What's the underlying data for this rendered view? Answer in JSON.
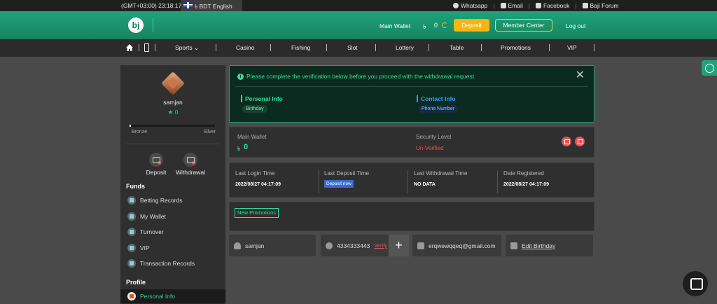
{
  "topbar": {
    "time": "(GMT+03:00) 23:18:17",
    "language": "৳ BDT English",
    "links": [
      "Whatsapp",
      "Email",
      "Facebook",
      "Baji Forum"
    ]
  },
  "header": {
    "logo": "bj",
    "main_wallet_label": "Main Wallet",
    "currency": "৳",
    "balance": "0",
    "deposit_label": "Deposit",
    "member_center_label": "Member Center",
    "logout_label": "Log out",
    "accent": "#1fa37a",
    "deposit_color": "#f8b510"
  },
  "nav": {
    "items": [
      "Sports ⌄",
      "Casino",
      "Fishing",
      "Slot",
      "Lottery",
      "Table",
      "Promotions",
      "VIP"
    ]
  },
  "sidebar": {
    "username": "samjan",
    "stars": "★ 0",
    "progress_fraction": 0.01,
    "level_left": "Bronze",
    "level_right": "Silver",
    "quick_actions": [
      "Deposit",
      "Withdrawal"
    ],
    "funds_title": "Funds",
    "funds_items": [
      "Betting Records",
      "My Wallet",
      "Turnover",
      "VIP",
      "Transaction Records"
    ],
    "profile_title": "Profile",
    "profile_items": [
      "Personal Info"
    ]
  },
  "alert": {
    "message": "Please complete the verification below before you proceed with the withdrawal request.",
    "personal_title": "Personal Info",
    "personal_chip": "Birthday",
    "contact_title": "Contact Info",
    "contact_chip": "Phone Number",
    "close": "✕"
  },
  "wallet": {
    "main_wallet_label": "Main Wallet",
    "currency": "৳",
    "value": "0",
    "security_label": "Security Level",
    "security_value": "Un-Verified"
  },
  "stats": {
    "last_login_label": "Last Login Time",
    "last_login_value": "2022/08/27 04:17:09",
    "last_deposit_label": "Last Deposit Time",
    "deposit_now": "Deposit now",
    "last_withdrawal_label": "Last Withdrawal Time",
    "last_withdrawal_value": "NO DATA",
    "registered_label": "Date Registered",
    "registered_value": "2022/08/27 04:17:09"
  },
  "promotions": {
    "new_promotions": "New Promotions"
  },
  "personal": {
    "username": "samjan",
    "phone": "4334333443",
    "verify": "Verify",
    "plus": "+",
    "email": "erqwewqqeq@gmail.com",
    "edit_birthday": "Edit Birthday"
  }
}
